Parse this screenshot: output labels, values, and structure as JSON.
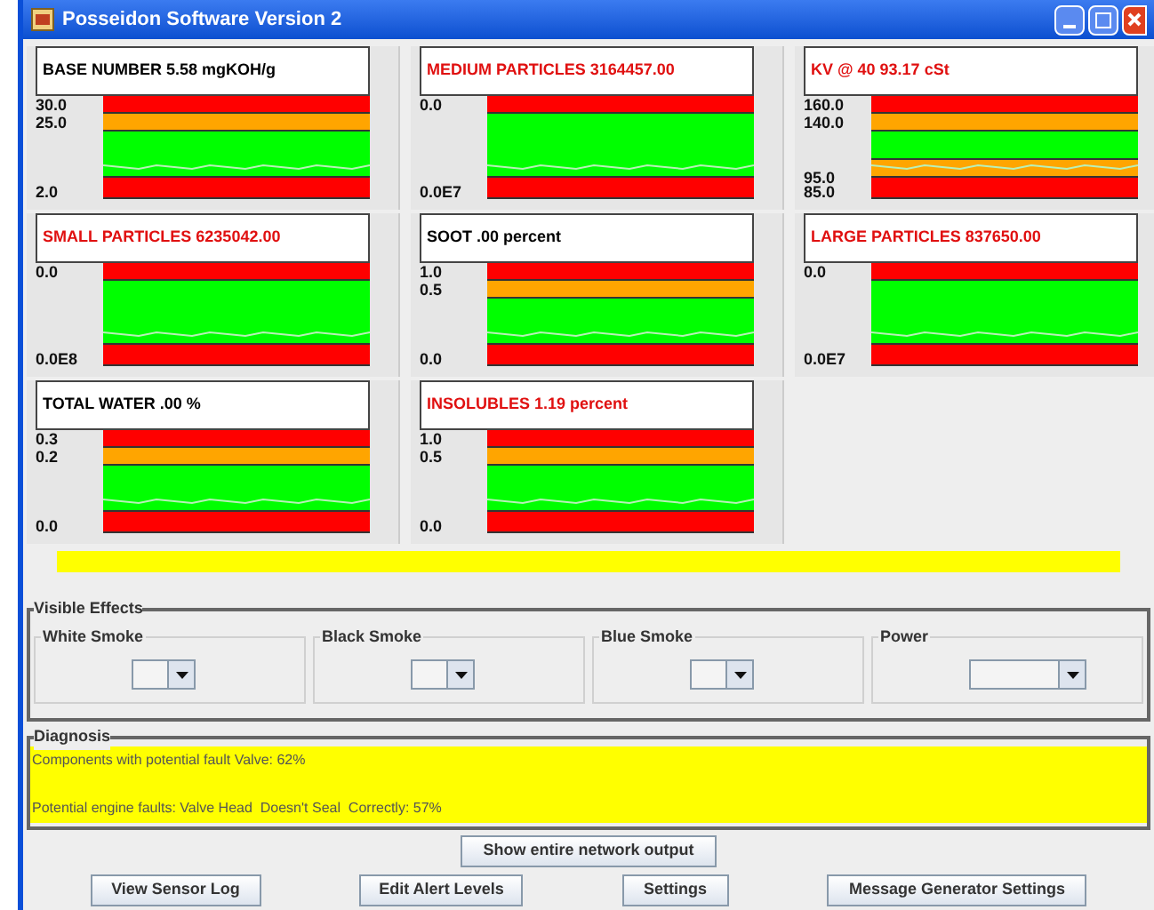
{
  "window": {
    "title": "Posseidon Software Version 2"
  },
  "gauges": [
    {
      "title": "BASE NUMBER 5.58 mgKOH/g",
      "alert": false,
      "labels": [
        {
          "text": "30.0",
          "kind": "top"
        },
        {
          "text": "25.0",
          "kind": "top"
        },
        {
          "text": "2.0",
          "kind": "bottom"
        }
      ],
      "bands": [
        {
          "color": "#ff0000"
        },
        {
          "color": "#ffa500"
        },
        {
          "color": "#00ff00"
        },
        {
          "color": "#ff0000"
        }
      ]
    },
    {
      "title": "MEDIUM PARTICLES 3164457.00",
      "alert": true,
      "labels": [
        {
          "text": "0.0",
          "kind": "top"
        },
        {
          "text": "0.0E7",
          "kind": "bottom"
        }
      ],
      "bands": [
        {
          "color": "#ff0000"
        },
        {
          "color": "#00ff00"
        },
        {
          "color": "#ff0000"
        }
      ]
    },
    {
      "title": "KV @ 40 93.17 cSt",
      "alert": true,
      "labels": [
        {
          "text": "160.0",
          "kind": "top"
        },
        {
          "text": "140.0",
          "kind": "top"
        },
        {
          "text": "95.0",
          "kind": "bottom"
        },
        {
          "text": "85.0",
          "kind": "bottom"
        }
      ],
      "bands": [
        {
          "color": "#ff0000"
        },
        {
          "color": "#ffa500"
        },
        {
          "color": "#00ff00"
        },
        {
          "color": "#ffa500"
        },
        {
          "color": "#ff0000"
        }
      ]
    },
    {
      "title": "SMALL PARTICLES 6235042.00",
      "alert": true,
      "labels": [
        {
          "text": "0.0",
          "kind": "top"
        },
        {
          "text": "0.0E8",
          "kind": "bottom"
        }
      ],
      "bands": [
        {
          "color": "#ff0000"
        },
        {
          "color": "#00ff00"
        },
        {
          "color": "#ff0000"
        }
      ]
    },
    {
      "title": "SOOT .00 percent",
      "alert": false,
      "labels": [
        {
          "text": "1.0",
          "kind": "top"
        },
        {
          "text": "0.5",
          "kind": "top"
        },
        {
          "text": "0.0",
          "kind": "bottom"
        }
      ],
      "bands": [
        {
          "color": "#ff0000"
        },
        {
          "color": "#ffa500"
        },
        {
          "color": "#00ff00"
        },
        {
          "color": "#ff0000"
        }
      ]
    },
    {
      "title": "LARGE PARTICLES 837650.00",
      "alert": true,
      "labels": [
        {
          "text": "0.0",
          "kind": "top"
        },
        {
          "text": "0.0E7",
          "kind": "bottom"
        }
      ],
      "bands": [
        {
          "color": "#ff0000"
        },
        {
          "color": "#00ff00"
        },
        {
          "color": "#ff0000"
        }
      ]
    },
    {
      "title": "TOTAL WATER .00 %",
      "alert": false,
      "labels": [
        {
          "text": "0.3",
          "kind": "top"
        },
        {
          "text": "0.2",
          "kind": "top"
        },
        {
          "text": "0.0",
          "kind": "bottom"
        }
      ],
      "bands": [
        {
          "color": "#ff0000"
        },
        {
          "color": "#ffa500"
        },
        {
          "color": "#00ff00"
        },
        {
          "color": "#ff0000"
        }
      ]
    },
    {
      "title": "INSOLUBLES 1.19 percent",
      "alert": true,
      "labels": [
        {
          "text": "1.0",
          "kind": "top"
        },
        {
          "text": "0.5",
          "kind": "top"
        },
        {
          "text": "0.0",
          "kind": "bottom"
        }
      ],
      "bands": [
        {
          "color": "#ff0000"
        },
        {
          "color": "#ffa500"
        },
        {
          "color": "#00ff00"
        },
        {
          "color": "#ff0000"
        }
      ]
    }
  ],
  "visible_effects": {
    "title": "Visible Effects",
    "groups": [
      {
        "label": "White Smoke"
      },
      {
        "label": "Black Smoke"
      },
      {
        "label": "Blue Smoke"
      },
      {
        "label": "Power"
      }
    ]
  },
  "diagnosis": {
    "title": "Diagnosis",
    "lines": [
      "Components with potential fault Valve: 62%",
      "Potential engine faults: Valve Head  Doesn't Seal  Correctly: 57%"
    ]
  },
  "show_button": "Show entire network output",
  "buttons": [
    "View Sensor Log",
    "Edit Alert Levels",
    "Settings",
    "Message Generator Settings"
  ]
}
